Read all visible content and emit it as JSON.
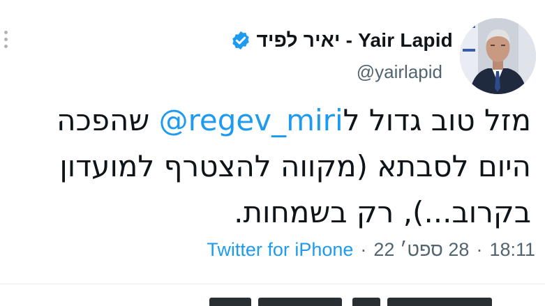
{
  "tweet": {
    "display_name": "יאיר לפיד - Yair Lapid",
    "handle": "@yairlapid",
    "text_before_mention": "מזל טוב גדול ל",
    "mention": "@regev_miri",
    "text_after_mention": " שהפכה היום לסבתא (מקווה להצטרף למועדון בקרוב...), רק בשמחות.",
    "time": "18:11",
    "date": "28 ספט׳ 22",
    "separator": "·",
    "source": "Twitter for iPhone"
  },
  "colors": {
    "link": "#1d9bf0",
    "text": "#0f1419",
    "secondary": "#536471",
    "verified": "#1d9bf0"
  },
  "icons": {
    "verified": "verified-badge-icon",
    "more": "more-options-icon"
  }
}
